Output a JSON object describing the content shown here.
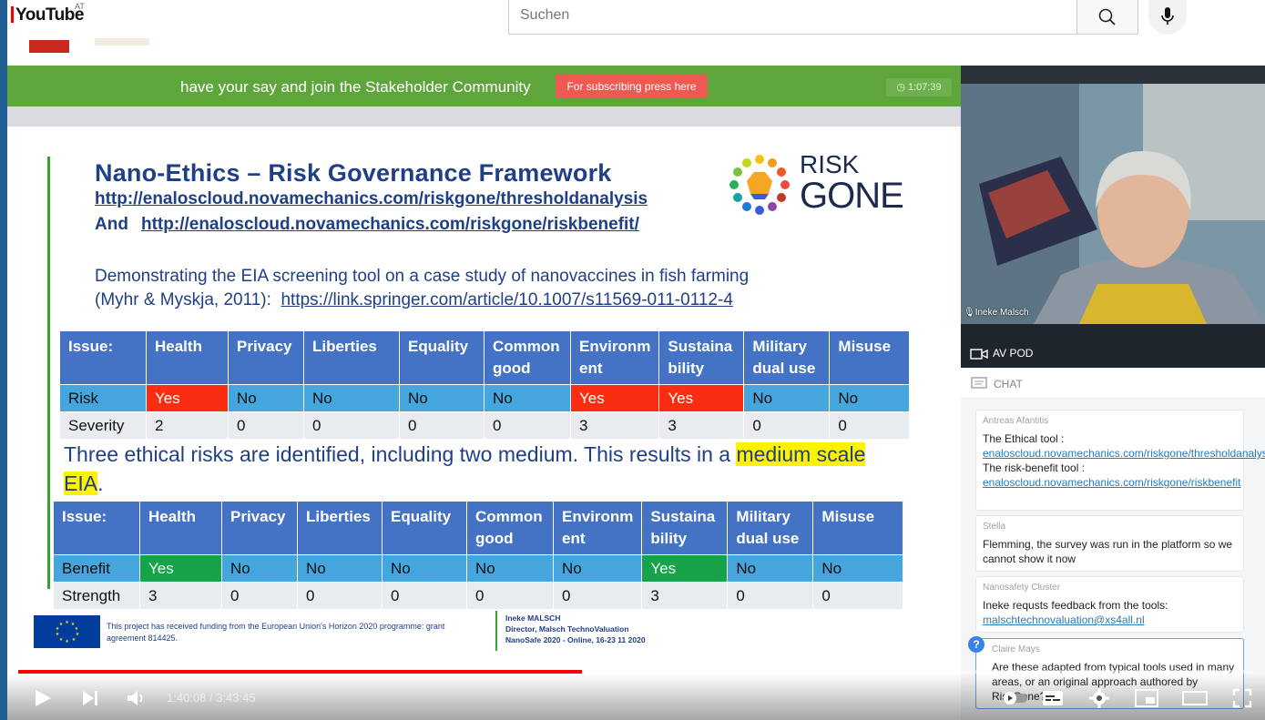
{
  "youtube": {
    "logo": "YouTube",
    "region": "AT",
    "search_placeholder": "Suchen"
  },
  "banner": {
    "text": "have your say and join the Stakeholder Community",
    "subscribe_button": "For subscribing press here",
    "timer": "1:07:39"
  },
  "slide": {
    "title": "Nano-Ethics – Risk Governance Framework",
    "link1": "http://enaloscloud.novamechanics.com/riskgone/thresholdanalysis",
    "and_label": "And",
    "link2": "http://enaloscloud.novamechanics.com/riskgone/riskbenefit/",
    "demo_line1": "Demonstrating the EIA screening tool on a case study of nanovaccines in fish farming",
    "demo_line2_prefix": "(Myhr & Myskja, 2011):",
    "demo_line2_link": "https://link.springer.com/article/10.1007/s11569-011-0112-4",
    "logo_risk": "RISK",
    "logo_gone": "GONE",
    "table1": {
      "headers": [
        "Issue:",
        "Health",
        "Privacy",
        "Liberties",
        "Equality",
        "Common good",
        "Environm ent",
        "Sustaina bility",
        "Military dual use",
        "Misuse"
      ],
      "row1": [
        "Risk",
        "Yes",
        "No",
        "No",
        "No",
        "No",
        "Yes",
        "Yes",
        "No",
        "No"
      ],
      "row2": [
        "Severity",
        "2",
        "0",
        "0",
        "0",
        "0",
        "3",
        "3",
        "0",
        "0"
      ]
    },
    "result_pre": "Three ethical risks are identified, including two medium. This results in a ",
    "result_hl1": "medium scale",
    "result_hl2": "EIA",
    "result_post": ".",
    "table2": {
      "headers": [
        "Issue:",
        "Health",
        "Privacy",
        "Liberties",
        "Equality",
        "Common good",
        "Environm ent",
        "Sustaina bility",
        "Military dual use",
        "Misuse"
      ],
      "row1": [
        "Benefit",
        "Yes",
        "No",
        "No",
        "No",
        "No",
        "No",
        "Yes",
        "No",
        "No"
      ],
      "row2": [
        "Strength",
        "3",
        "0",
        "0",
        "0",
        "0",
        "0",
        "3",
        "0",
        "0"
      ]
    },
    "footer_text": "This project has received funding from the European Union's Horizon 2020 programme: grant agreement 814425.",
    "footer_name": "Ineke MALSCH",
    "footer_role": "Director, Malsch TechnoValuation",
    "footer_event": "NanoSafe 2020 - Online, 16-23 11 2020"
  },
  "panel": {
    "camera_name": "Ineke Malsch",
    "avpod_label": "AV POD",
    "chat_label": "CHAT",
    "messages": [
      {
        "author": "Antreas Afantitis",
        "pre": "The Ethical tool :",
        "link1": "enaloscloud.novamechanics.com/riskgone/thresholdanalysis",
        "mid": " The risk-benefit tool :",
        "link2": "enaloscloud.novamechanics.com/riskgone/riskbenefit"
      },
      {
        "author": "Stella",
        "text": "Flemming, the survey was run in the platform so we cannot show it now"
      },
      {
        "author": "Nanosafety Cluster",
        "text": "Ineke requsts feedback from the tools:",
        "link": "malschtechnovaluation@xs4all.nl"
      },
      {
        "author": "Claire Mays",
        "text": "Are these adapted from typical tools used in many areas, or an original approach authored by RiskGone?"
      }
    ]
  },
  "player": {
    "time": "1:40:08 / 3:43:45",
    "progress": 0.456
  },
  "colors": {
    "banner": "#5ea53c",
    "subscribe": "#ee5a52",
    "slide_blue": "#1f3f86",
    "table_header": "#4472c4",
    "risk_red": "#fa2d12",
    "benefit_green": "#16a34a",
    "highlight": "#fff200"
  }
}
